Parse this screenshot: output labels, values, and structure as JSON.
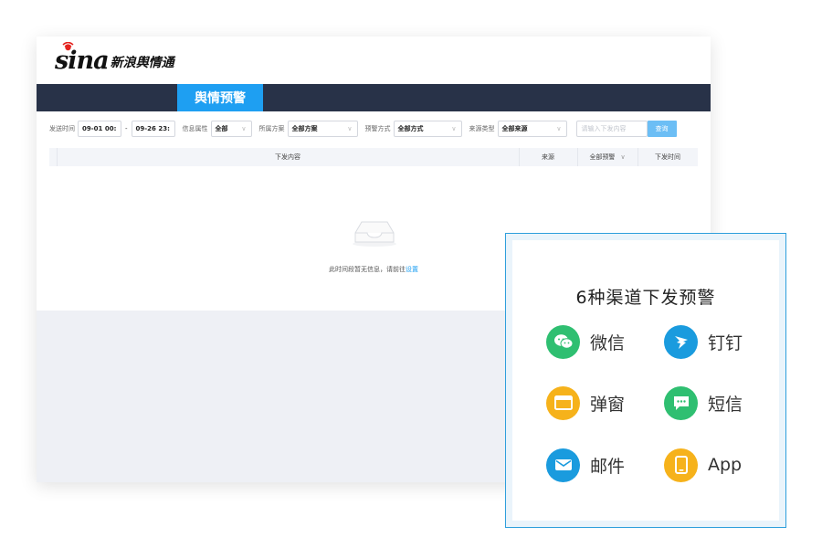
{
  "brand": {
    "logo_mark": "sina",
    "logo_sub": "新浪舆情通"
  },
  "nav": {
    "active_tab": "舆情预警"
  },
  "filters": {
    "send_time_label": "发送时间",
    "date_from": "09-01 00:",
    "date_sep": "-",
    "date_to": "09-26 23:",
    "info_attr_label": "信息属性",
    "info_attr_value": "全部",
    "scheme_label": "所属方案",
    "scheme_value": "全部方案",
    "method_label": "预警方式",
    "method_value": "全部方式",
    "source_type_label": "来源类型",
    "source_type_value": "全部来源",
    "search_placeholder": "请输入下发内容",
    "search_button": "查询"
  },
  "table": {
    "columns": [
      "下发内容",
      "来源",
      "全部预警",
      "下发时间"
    ]
  },
  "empty_state": {
    "message": "此时间段暂无信息，请前往",
    "link": "设置"
  },
  "overlay": {
    "title": "6种渠道下发预警",
    "channels": [
      {
        "label": "微信",
        "icon": "wechat-icon",
        "color": "#2fbf71"
      },
      {
        "label": "钉钉",
        "icon": "dingtalk-icon",
        "color": "#1a9bde"
      },
      {
        "label": "弹窗",
        "icon": "popup-window-icon",
        "color": "#f6b21b"
      },
      {
        "label": "短信",
        "icon": "sms-icon",
        "color": "#2fbf71"
      },
      {
        "label": "邮件",
        "icon": "mail-icon",
        "color": "#1a9bde"
      },
      {
        "label": "App",
        "icon": "app-phone-icon",
        "color": "#f6b21b"
      }
    ]
  },
  "colors": {
    "navbar": "#283248",
    "accent": "#1e9ff2",
    "overlay_border": "#2e9fdc"
  }
}
